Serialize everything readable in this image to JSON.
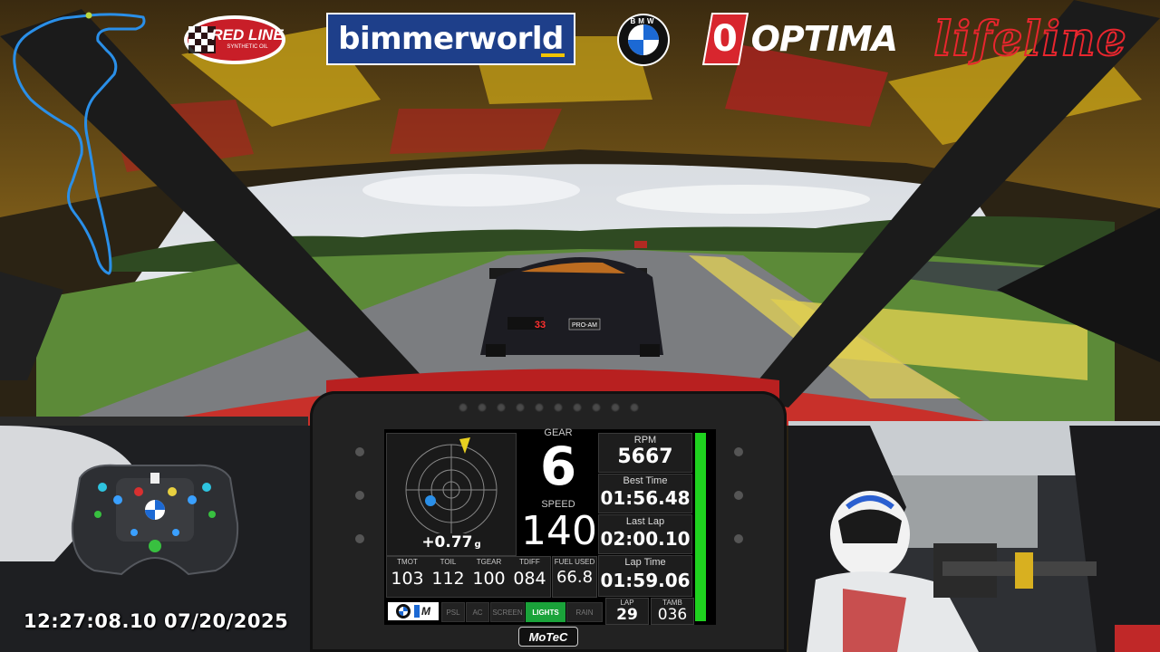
{
  "overlay": {
    "logos": {
      "redline_main": "RED LINE",
      "redline_sub": "SYNTHETIC OIL",
      "bimmerworld": "bimmerworld",
      "bmw": "BMW",
      "optima_mark": "0",
      "optima": "OPTIMA",
      "lifeline": "lifeline"
    },
    "timestamp": "12:27:08.10  07/20/2025",
    "track_map_icon": "track-map-icon",
    "steering_wheel_icon": "steering-wheel-icon"
  },
  "scene": {
    "car_number": "33",
    "car_class": "PRO-AM"
  },
  "dash": {
    "gforce": "+0.77",
    "gforce_unit": "g",
    "gear_label": "GEAR",
    "gear": "6",
    "speed_label": "SPEED",
    "speed": "140",
    "rpm_label": "RPM",
    "rpm": "5667",
    "best_time_label": "Best Time",
    "best_time": "01:56.48",
    "last_lap_label": "Last Lap",
    "last_lap": "02:00.10",
    "lap_time_label": "Lap Time",
    "lap_time": "01:59.06",
    "temps": [
      {
        "label": "TMOT",
        "value": "103"
      },
      {
        "label": "TOIL",
        "value": "112"
      },
      {
        "label": "TGEAR",
        "value": "100"
      },
      {
        "label": "TDIFF",
        "value": "084"
      }
    ],
    "fuel_label": "FUEL USED",
    "fuel": "66.8",
    "buttons": [
      "PSL",
      "AC",
      "SCREEN",
      "LIGHTS",
      "RAIN"
    ],
    "lap_label": "LAP",
    "lap": "29",
    "tamb_label": "TAMB",
    "tamb": "036",
    "brand": "MoTeC",
    "m_badge": "M",
    "shift_bar_fraction": 1.0
  },
  "colors": {
    "accent_red": "#d8262e",
    "lights_green": "#1aa33a",
    "track_blue": "#2a8fe8",
    "bimmerworld_blue": "#1e3f8a"
  }
}
